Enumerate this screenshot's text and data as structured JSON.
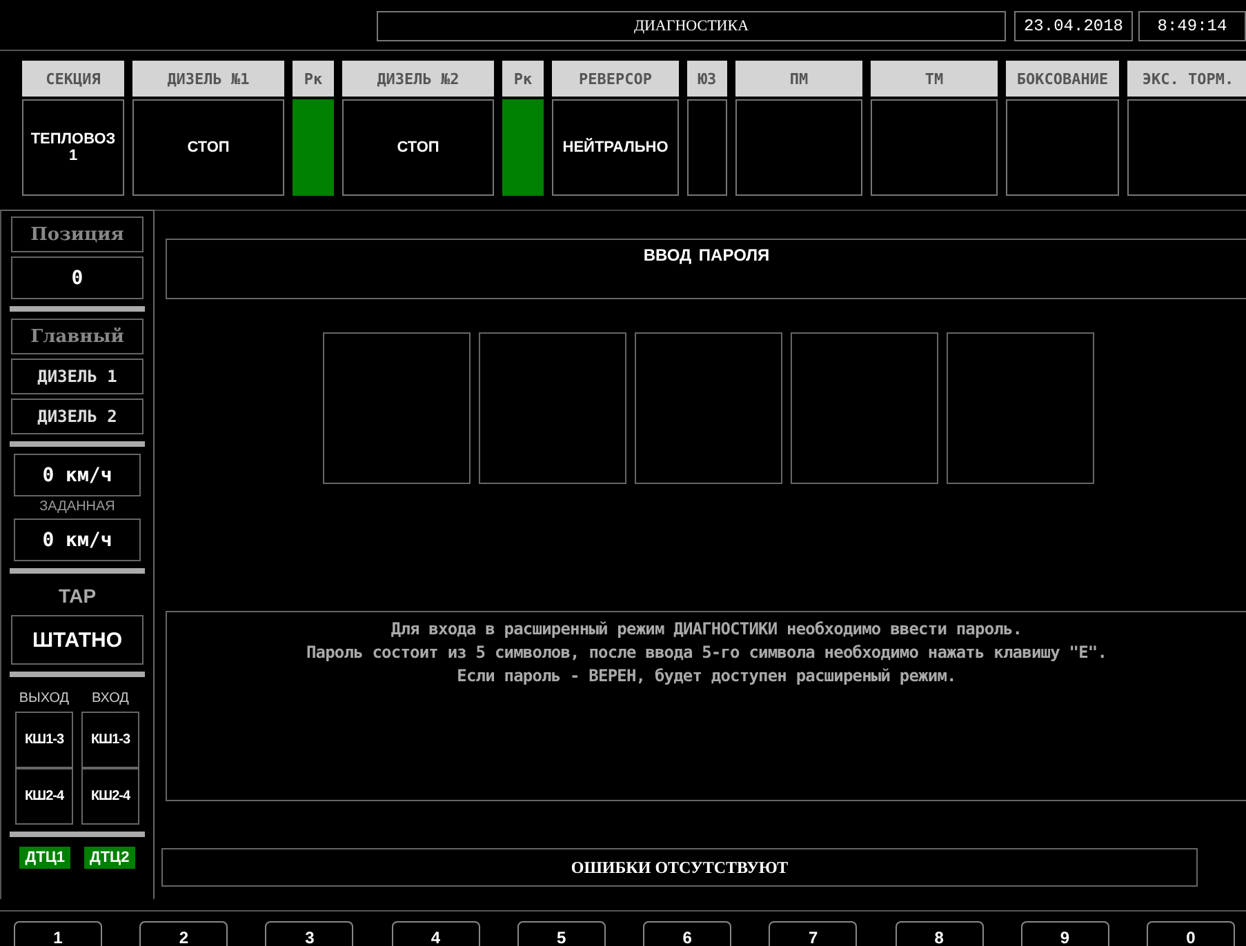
{
  "window": {
    "title": "ДИАГНОСТИКА",
    "date": "23.04.2018",
    "time": "8:49:14"
  },
  "columns": [
    {
      "label": "СЕКЦИЯ",
      "kind": "text",
      "value": "ТЕПЛОВОЗ 1"
    },
    {
      "label": "ДИЗЕЛЬ №1",
      "kind": "text",
      "value": "СТОП"
    },
    {
      "label": "Рк",
      "kind": "indicator",
      "on": true
    },
    {
      "label": "ДИЗЕЛЬ №2",
      "kind": "text",
      "value": "СТОП"
    },
    {
      "label": "Рк",
      "kind": "indicator",
      "on": true
    },
    {
      "label": "РЕВЕРСОР",
      "kind": "text",
      "value": "НЕЙТРАЛЬНО"
    },
    {
      "label": "ЮЗ",
      "kind": "indicator",
      "on": false
    },
    {
      "label": "ПМ",
      "kind": "indicator",
      "on": false
    },
    {
      "label": "ТМ",
      "kind": "indicator",
      "on": false
    },
    {
      "label": "БОКСОВАНИЕ",
      "kind": "indicator",
      "on": false
    },
    {
      "label": "ЭКС. ТОРМ.",
      "kind": "indicator",
      "on": false
    }
  ],
  "sidebar": {
    "position_label": "Позиция",
    "position_value": "0",
    "main_label": "Главный",
    "diesels": [
      "ДИЗЕЛЬ 1",
      "ДИЗЕЛЬ 2"
    ],
    "speed": "0 км/ч",
    "set_label": "ЗАДАННАЯ",
    "set_speed": "0 км/ч",
    "tar_label": "ТАР",
    "tar_value": "ШТАТНО",
    "out_label": "ВЫХОД",
    "in_label": "ВХОД",
    "out_items": [
      "КШ1-3",
      "КШ2-4"
    ],
    "in_items": [
      "КШ1-3",
      "КШ2-4"
    ],
    "dtc": [
      {
        "label": "ДТЦ1",
        "on": true
      },
      {
        "label": "ДТЦ2",
        "on": true
      }
    ]
  },
  "password": {
    "title": "ВВОД  ПАРОЛЯ",
    "slots": [
      {
        "filled": false
      },
      {
        "filled": false
      },
      {
        "filled": false
      },
      {
        "filled": false
      },
      {
        "filled": false
      }
    ]
  },
  "message": [
    "Для входа в расширенный режим ДИАГНОСТИКИ необходимо ввести пароль.",
    "Пароль состоит из 5 символов, после ввода 5-го символа необходимо нажать клавишу \"Е\".",
    "Если пароль - ВЕРЕН, будет доступен расширеный режим."
  ],
  "status": "ОШИБКИ ОТСУТСТВУЮТ",
  "keys": [
    "1",
    "2",
    "3",
    "4",
    "5",
    "6",
    "7",
    "8",
    "9",
    "0"
  ]
}
